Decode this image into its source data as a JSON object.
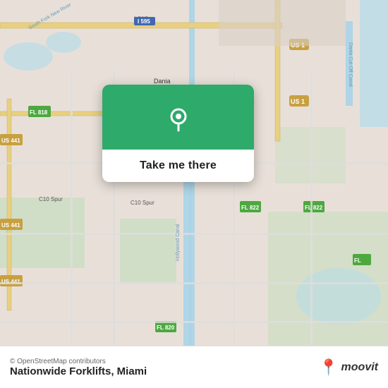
{
  "map": {
    "background_color": "#e8e0d8",
    "attribution": "© OpenStreetMap contributors",
    "alt": "Map of Miami area showing Nationwide Forklifts location"
  },
  "card": {
    "button_label": "Take me there",
    "pin_color": "#ffffff",
    "background_color": "#2eaa6b"
  },
  "bottom_bar": {
    "attribution": "© OpenStreetMap contributors",
    "location_name": "Nationwide Forklifts, Miami",
    "logo_text": "moovit"
  }
}
